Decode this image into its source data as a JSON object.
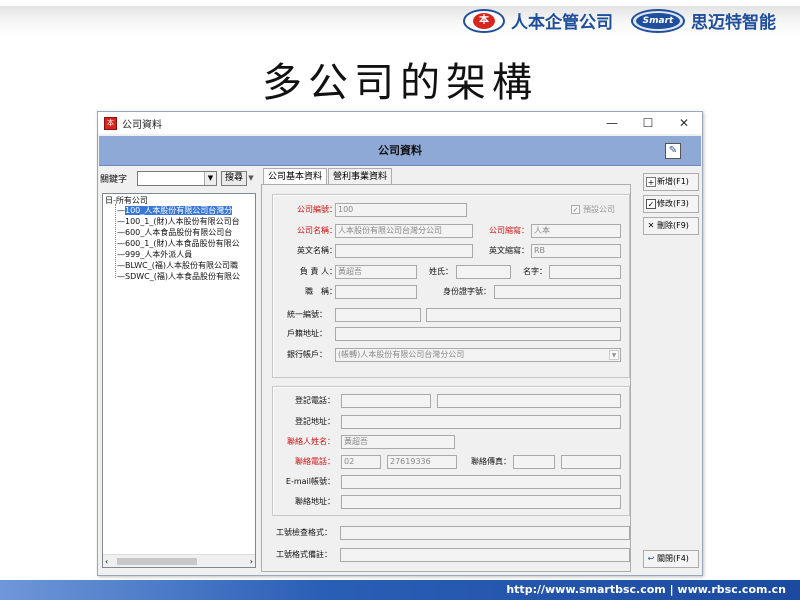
{
  "brands": [
    {
      "logo": "本",
      "name": "人本企管公司"
    },
    {
      "logo": "Smart",
      "name": "思迈特智能"
    }
  ],
  "slide_title": "多公司的架構",
  "window": {
    "title": "公司資料",
    "controls": {
      "minimize": "—",
      "maximize": "☐",
      "close": "✕"
    },
    "header_title": "公司資料",
    "keyword_label": "關鍵字",
    "search_button": "搜尋",
    "tree": {
      "root": "日-所有公司",
      "items": [
        "100_人本股份有限公司台灣分",
        "100_1_(財)人本股份有限公司台",
        "600_人本食品股份有限公司台",
        "600_1_(財)人本食品股份有限公",
        "999_人本外派人員",
        "BLWC_(福)人本股份有限公司職",
        "SDWC_(福)人本食品股份有限公"
      ]
    },
    "tabs": [
      "公司基本資料",
      "營利事業資料"
    ],
    "form": {
      "company_code_label": "公司編號：",
      "company_code_value": "100",
      "default_company_label": "預設公司",
      "company_name_label": "公司名稱：",
      "company_name_value": "人本股份有限公司台灣分公司",
      "company_abbr_label": "公司縮寫：",
      "company_abbr_value": "人本",
      "en_name_label": "英文名稱：",
      "en_abbr_label": "英文縮寫：",
      "en_abbr_value": "RB",
      "owner_label": "負 責 人：",
      "owner_value": "黃超吾",
      "surname_label": "姓氏：",
      "given_name_label": "名字：",
      "title_label": "職　稱：",
      "id_label": "身份證字號：",
      "tax_id_label": "統一編號：",
      "household_addr_label": "戶籍地址：",
      "bank_label": "銀行帳戶：",
      "bank_value": "(帳轉)人本股份有限公司台灣分公司",
      "reg_phone_label": "登記電話：",
      "reg_addr_label": "登記地址：",
      "contact_name_label": "聯絡人姓名：",
      "contact_name_value": "黃超吾",
      "contact_phone_label": "聯絡電話：",
      "contact_phone_area": "02",
      "contact_phone_number": "27619336",
      "contact_fax_label": "聯絡傳真：",
      "email_label": "E-mail帳號：",
      "contact_addr_label": "聯絡地址：",
      "emp_no_format_label": "工號檢查格式：",
      "emp_no_note_label": "工號格式備註："
    },
    "buttons": {
      "add": "新增(F1)",
      "edit": "修改(F3)",
      "delete": "刪除(F9)",
      "close": "關閉(F4)"
    }
  },
  "footer": "http://www.smartbsc.com   |  www.rbsc.com.cn",
  "colors": {
    "header_band": "#8fa9d6",
    "footer": "#2a5fb6",
    "required_label": "#d01010",
    "brand": "#1f4e9c"
  }
}
